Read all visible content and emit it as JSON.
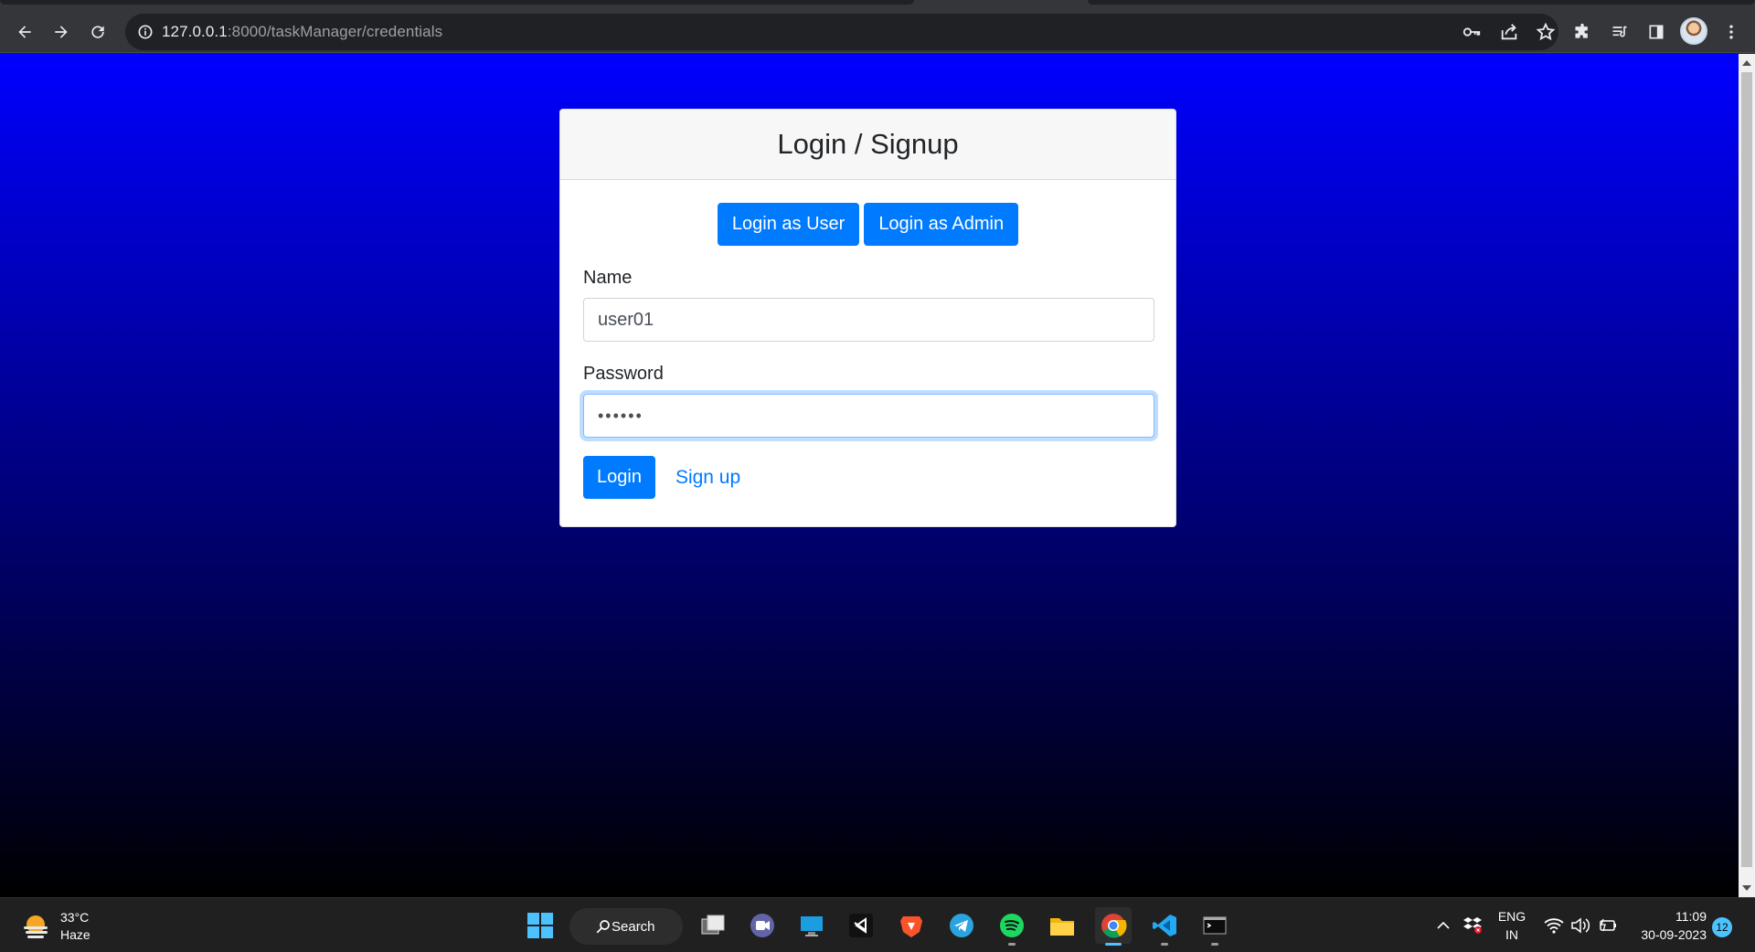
{
  "browser": {
    "url_host": "127.0.0.1",
    "url_rest": ":8000/taskManager/credentials",
    "icons": [
      "back-arrow-icon",
      "forward-arrow-icon",
      "reload-icon",
      "site-info-icon",
      "key-icon",
      "share-icon",
      "bookmark-star-icon",
      "extensions-icon",
      "reading-list-icon",
      "side-panel-icon",
      "profile-avatar",
      "more-menu-icon"
    ]
  },
  "page": {
    "background_top": "#0000ff",
    "background_bottom": "#000000",
    "card": {
      "title": "Login / Signup",
      "login_user_label": "Login as User",
      "login_admin_label": "Login as Admin",
      "name_label": "Name",
      "name_value": "user01",
      "password_label": "Password",
      "password_value": "••••••",
      "login_button": "Login",
      "signup_link": "Sign up"
    },
    "accent": "#007bff"
  },
  "taskbar": {
    "weather_temp": "33°C",
    "weather_cond": "Haze",
    "search_label": "Search",
    "apps": [
      "start-icon",
      "task-view-icon",
      "teams-chat-icon",
      "remote-desktop-icon",
      "visual-studio-icon",
      "brave-browser-icon",
      "telegram-icon",
      "spotify-icon",
      "file-explorer-icon",
      "chrome-icon",
      "vscode-icon",
      "terminal-icon"
    ],
    "lang_line1": "ENG",
    "lang_line2": "IN",
    "time": "11:09",
    "date": "30-09-2023",
    "notification_count": "12"
  }
}
